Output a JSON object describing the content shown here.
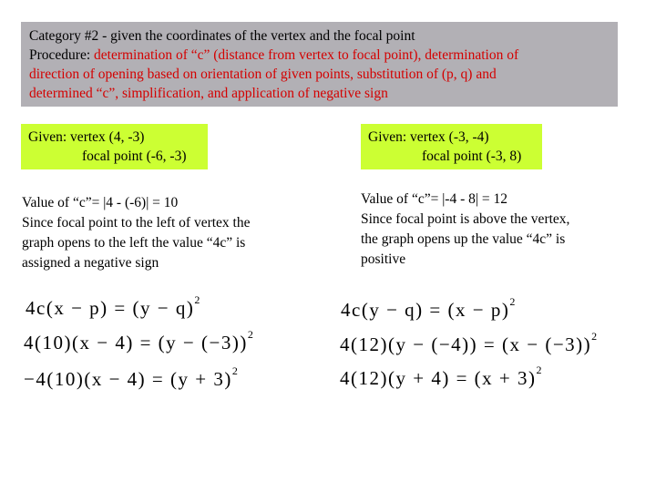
{
  "header": {
    "line1": "Category #2 - given the coordinates of the vertex and the focal point",
    "procedure_label": "Procedure: ",
    "procedure_text_1": "determination of “c” (distance from vertex to focal point), determination of",
    "procedure_text_2": "direction of opening based on orientation of given points, substitution of (p, q) and",
    "procedure_text_3": "determined “c”, simplification, and application of negative sign"
  },
  "left": {
    "given_line1": "Given: vertex (4, -3)",
    "given_line2": "focal point (-6, -3)",
    "explain": [
      "Value of “c”=  |4 - (-6)| = 10",
      "Since focal point to the left of vertex the",
      "graph opens to the left  the value “4c” is",
      "assigned a negative sign"
    ],
    "equations": [
      {
        "lhs": "4c(x − p)",
        "rhs": "(y − q)",
        "exp": "2"
      },
      {
        "lhs": "4(10)(x − 4)",
        "rhs": "(y − (−3))",
        "exp": "2"
      },
      {
        "lhs": "−4(10)(x − 4)",
        "rhs": "(y + 3)",
        "exp": "2"
      }
    ]
  },
  "right": {
    "given_line1": "Given: vertex (-3, -4)",
    "given_line2": "focal point (-3, 8)",
    "explain": [
      "Value of “c”=  |-4 - 8| = 12",
      "Since focal point is above the vertex,",
      "the graph opens up the value “4c” is",
      "positive"
    ],
    "equations": [
      {
        "lhs": "4c(y − q)",
        "rhs": "(x − p)",
        "exp": "2"
      },
      {
        "lhs": "4(12)(y − (−4))",
        "rhs": "(x − (−3))",
        "exp": "2"
      },
      {
        "lhs": "4(12)(y + 4)",
        "rhs": "(x + 3)",
        "exp": "2"
      }
    ]
  },
  "colors": {
    "header_bg": "#b2b0b5",
    "given_bg": "#ccff33",
    "procedure_text": "#d40000"
  }
}
